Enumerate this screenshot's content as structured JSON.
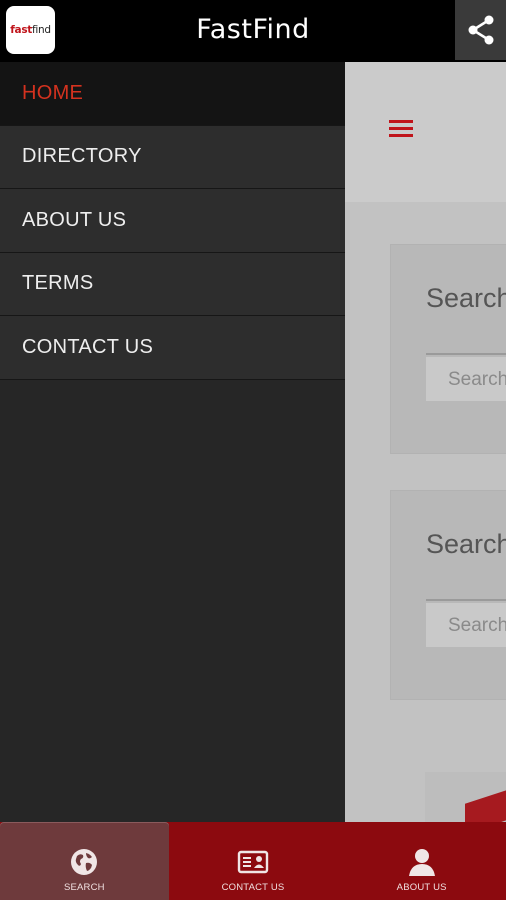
{
  "app": {
    "title": "FastFind",
    "logo": {
      "part1": "fast",
      "part2": "find"
    }
  },
  "drawer": {
    "items": [
      {
        "label": "HOME",
        "active": true
      },
      {
        "label": "DIRECTORY",
        "active": false
      },
      {
        "label": "ABOUT US",
        "active": false
      },
      {
        "label": "TERMS",
        "active": false
      },
      {
        "label": "CONTACT US",
        "active": false
      }
    ]
  },
  "content": {
    "cards": [
      {
        "title": "Search",
        "placeholder": "Search"
      },
      {
        "title": "Search",
        "placeholder": "Search"
      }
    ]
  },
  "bottom_nav": {
    "tabs": [
      {
        "label": "SEARCH",
        "icon": "globe-icon",
        "active": true
      },
      {
        "label": "CONTACT US",
        "icon": "contact-card-icon",
        "active": false
      },
      {
        "label": "ABOUT US",
        "icon": "person-icon",
        "active": false
      }
    ]
  },
  "colors": {
    "accent": "#c0141b",
    "bottom_bar": "#8c0a0f",
    "drawer_bg": "#262626"
  }
}
